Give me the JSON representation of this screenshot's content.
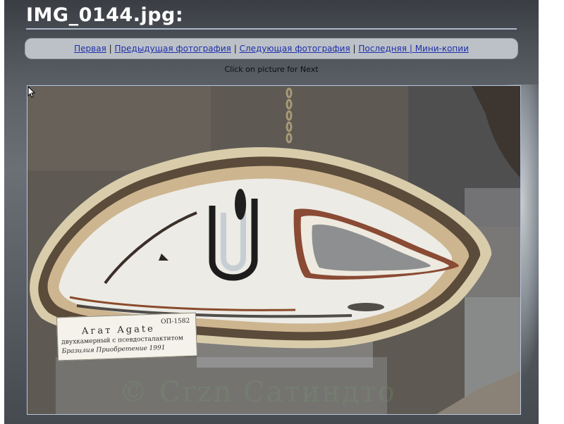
{
  "page": {
    "title": "IMG_0144.jpg:",
    "hint": "Click on picture for Next"
  },
  "nav": {
    "first": "Первая",
    "prev": "Предыдущая фотография",
    "next": "Следующая фотография",
    "last": "Последняя",
    "thumbs": "Мини-копии",
    "separator": "|"
  },
  "photo": {
    "label_code": "ОП-1582",
    "label_name": "Агат    Agate",
    "label_desc": "двухкамерный с псевдосталактитом",
    "label_origin": "Бразилия    Приобретение 1991",
    "watermark": "© Сrzn Сатиндто"
  },
  "colors": {
    "page_bg": "#4b5057",
    "navbar_bg": "#bcc1c8",
    "link": "#1f2fa8",
    "title_rule": "#aeb8cb"
  }
}
